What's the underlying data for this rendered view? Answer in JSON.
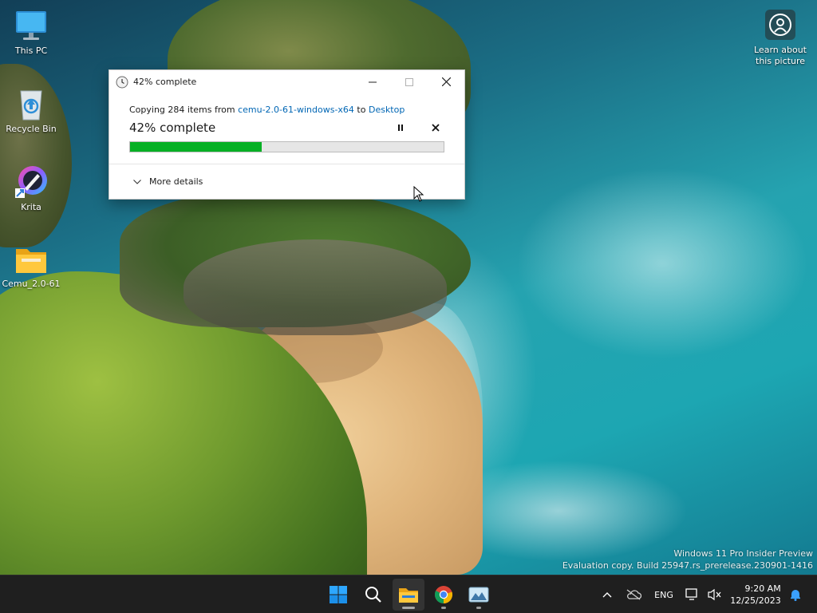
{
  "desktop": {
    "icons": [
      {
        "label": "This PC"
      },
      {
        "label": "Recycle Bin"
      },
      {
        "label": "Krita"
      },
      {
        "label": "Cemu_2.0-61"
      }
    ],
    "learn_label": "Learn about this picture",
    "watermark": {
      "line1": "Windows 11 Pro Insider Preview",
      "line2": "Evaluation copy. Build 25947.rs_prerelease.230901-1416"
    }
  },
  "dialog": {
    "title": "42% complete",
    "copy_prefix": "Copying 284 items from ",
    "source": "cemu-2.0-61-windows-x64",
    "copy_mid": " to ",
    "destination": "Desktop",
    "percent_label": "42% complete",
    "progress": 0.42,
    "more_details_label": "More details",
    "colors": {
      "progress": "#06b025",
      "link": "#0066b4"
    }
  },
  "taskbar": {
    "apps": [
      "start-icon",
      "search-icon",
      "file-explorer-icon",
      "chrome-icon",
      "photo-viewer-icon"
    ],
    "active_app": "file-explorer-icon",
    "language": "ENG",
    "time": "9:20 AM",
    "date": "12/25/2023"
  }
}
